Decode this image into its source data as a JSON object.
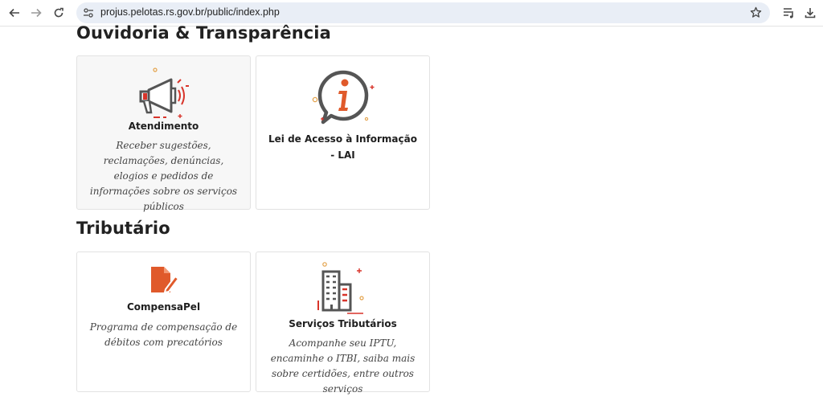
{
  "browser": {
    "url": "projus.pelotas.rs.gov.br/public/index.php"
  },
  "sections": {
    "ouvidoria": {
      "title": "Ouvidoria & Transparência",
      "cards": [
        {
          "title": "Atendimento",
          "description": "Receber sugestões, reclamações, denúncias, elogios e pedidos de informações sobre os serviços públicos",
          "icon": "megaphone-icon"
        },
        {
          "title": "Lei de Acesso à Informação - LAI",
          "description": "",
          "icon": "info-bubble-icon"
        }
      ]
    },
    "tributario": {
      "title": "Tributário",
      "cards": [
        {
          "title": "CompensaPel",
          "description": "Programa de compensação de débitos com precatórios",
          "icon": "document-edit-icon"
        },
        {
          "title": "Serviços Tributários",
          "description": "Acompanhe seu IPTU, encaminhe o ITBI, saiba mais sobre certidões, entre outros serviços",
          "icon": "buildings-icon"
        }
      ]
    }
  },
  "colors": {
    "accent": "#e05a2b",
    "icon_dark": "#555555",
    "icon_red": "#d8342a"
  }
}
